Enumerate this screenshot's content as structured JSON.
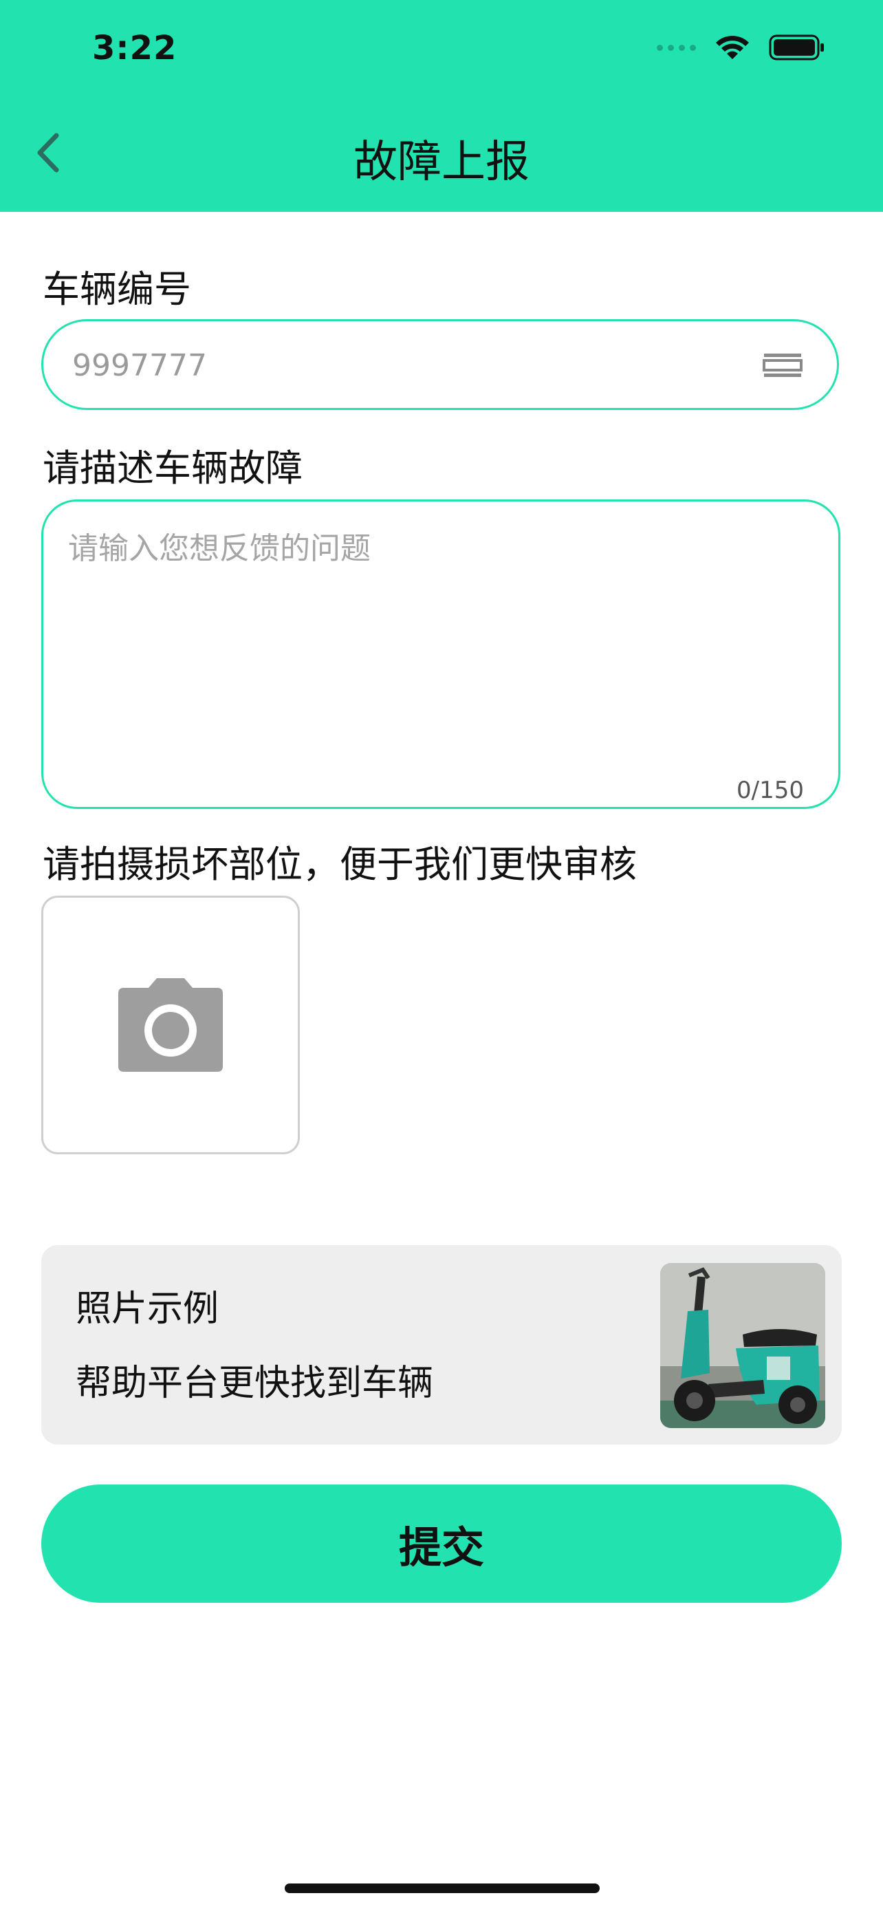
{
  "status_bar": {
    "time": "3:22"
  },
  "nav": {
    "title": "故障上报",
    "back_icon": "chevron-left-icon"
  },
  "form": {
    "vehicle_number": {
      "label": "车辆编号",
      "value": "9997777",
      "scan_icon": "scan-list-icon"
    },
    "description": {
      "label": "请描述车辆故障",
      "placeholder": "请输入您想反馈的问题",
      "counter": "0/150"
    },
    "photo": {
      "label": "请拍摄损坏部位，便于我们更快审核",
      "icon": "camera-icon"
    }
  },
  "example_card": {
    "title": "照片示例",
    "description": "帮助平台更快找到车辆",
    "image": "electric-scooter-photo"
  },
  "submit": {
    "label": "提交"
  },
  "colors": {
    "accent": "#22e3b0",
    "card_background": "#eeeeee",
    "placeholder_text": "#9a9a9a",
    "icon_gray": "#9e9e9e"
  }
}
